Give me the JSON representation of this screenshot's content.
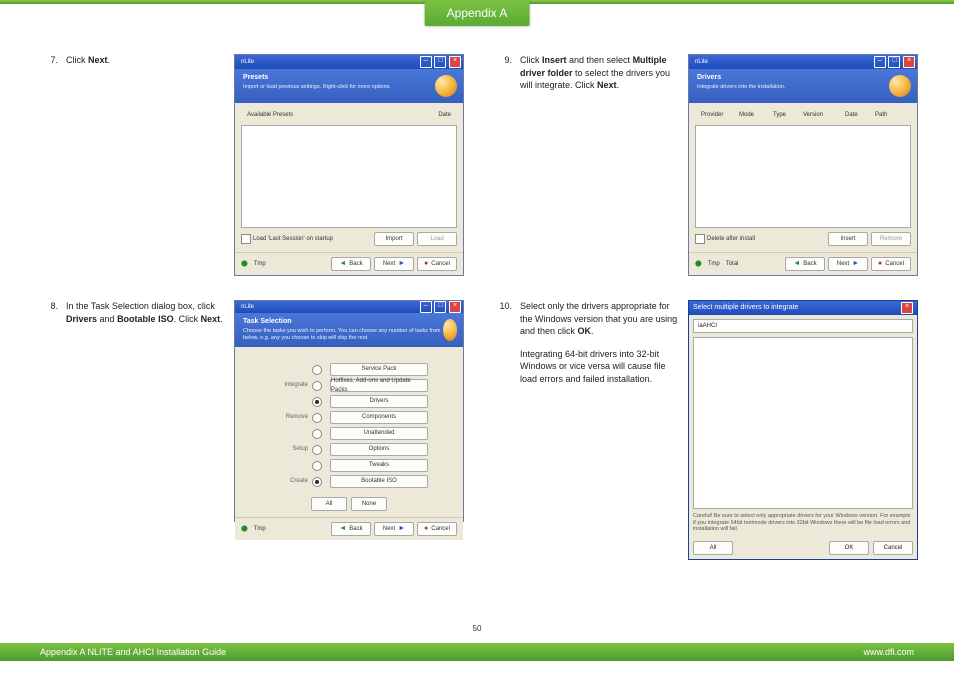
{
  "header": {
    "tab": "Appendix A"
  },
  "page_number": "50",
  "footer": {
    "left": "Appendix A NLITE and AHCI Installation Guide",
    "right": "www.dfi.com"
  },
  "steps": {
    "s7": {
      "num": "7.",
      "text": "Click <b>Next</b>."
    },
    "s8": {
      "num": "8.",
      "text": "In the Task Selection dialog box, click <b>Drivers</b> and <b>Bootable ISO</b>. Click <b>Next</b>."
    },
    "s9": {
      "num": "9.",
      "text": "Click <b>Insert</b> and then select <b>Multiple driver folder</b> to select the drivers you will integrate. Click <b>Next</b>."
    },
    "s10": {
      "num": "10.",
      "text": "Select only the drivers appropriate for the Windows version that you are using and then click <b>OK</b>.",
      "text2": "Integrating 64-bit drivers into 32-bit Windows or vice versa will cause file load errors and failed installation."
    }
  },
  "win_presets": {
    "app": "nLite",
    "banner_title": "Presets",
    "banner_sub": "Import or load previous settings. Right-click for more options.",
    "cols": {
      "left": "Available Presets",
      "right": "Date"
    },
    "chk": "Load 'Last Session' on startup",
    "btns": {
      "import": "Import",
      "load": "Load",
      "back": "Back",
      "next": "Next",
      "cancel": "Cancel"
    },
    "tmp": "Tmp"
  },
  "win_tasks": {
    "app": "nLite",
    "banner_title": "Task Selection",
    "banner_sub": "Choose the tasks you wish to perform. You can choose any number of tasks from below, e.g. any you choose to skip will skip the rest.",
    "groups": {
      "integrate": "Integrate",
      "remove": "Remove",
      "setup": "Setup",
      "create": "Create"
    },
    "items": {
      "servicepack": "Service Pack",
      "hotfixes": "Hotfixes, Add-ons and Update Packs",
      "drivers": "Drivers",
      "components": "Components",
      "unattended": "Unattended",
      "options": "Options",
      "tweaks": "Tweaks",
      "bootiso": "Bootable ISO"
    },
    "all": "All",
    "none": "None",
    "tmp": "Tmp",
    "btns": {
      "back": "Back",
      "next": "Next",
      "cancel": "Cancel"
    }
  },
  "win_drivers": {
    "app": "nLite",
    "banner_title": "Drivers",
    "banner_sub": "Integrate drivers into the installation.",
    "cols": {
      "provider": "Provider",
      "mode": "Mode",
      "type": "Type",
      "version": "Version",
      "date": "Date",
      "path": "Path"
    },
    "chk": "Delete after install",
    "btns": {
      "insert": "Insert",
      "remove": "Remove",
      "back": "Back",
      "next": "Next",
      "cancel": "Cancel"
    },
    "tmp": "Tmp",
    "total": "Total"
  },
  "modal_select": {
    "title": "Select multiple drivers to integrate",
    "pathfolder": "iaAHCI",
    "chk": "All",
    "warn": "Careful! Be sure to select only appropriate drivers for your Windows version. For example if you integrate 64bit textmode drivers into 32bit Windows there will be file load errors and installation will fail.",
    "btns": {
      "all": "All",
      "ok": "OK",
      "cancel": "Cancel"
    }
  }
}
